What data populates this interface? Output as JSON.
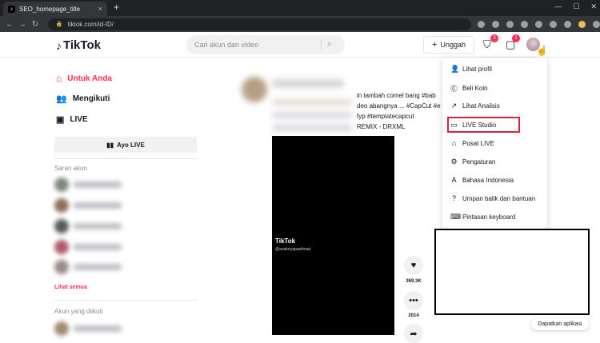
{
  "browser": {
    "tab_title": "SEO_homepage_title",
    "tab_close": "×",
    "new_tab": "+",
    "back": "←",
    "forward": "→",
    "reload": "↻",
    "url": "tiktok.com/id-ID/",
    "window_controls": [
      "—",
      "☐",
      "✕"
    ]
  },
  "header": {
    "logo_text": "TikTok",
    "search_placeholder": "Cari akun dan video",
    "upload_label": "Unggah",
    "inbox_badge": "3",
    "messages_badge": "1"
  },
  "sidebar": {
    "nav": [
      {
        "label": "Untuk Anda",
        "active": true
      },
      {
        "label": "Mengikuti",
        "active": false
      },
      {
        "label": "LIVE",
        "active": false
      }
    ],
    "go_live_label": "Ayo LIVE",
    "suggested_label": "Saran akun",
    "see_all_label": "Lihat semua",
    "following_label": "Akun yang diikuti"
  },
  "feed": {
    "caption_lines": [
      "in tambah comel bang #bab",
      "deo abangnya ... #CapCut #e",
      "fyp #templatecapcut",
      "REMIX - DRXML"
    ],
    "video_logo": "TikTok",
    "video_user": "@anaknyapaalimad",
    "likes": "369.3K",
    "comments": "2014"
  },
  "dropdown": {
    "items": [
      {
        "label": "Lihat profil",
        "icon": "user-icon"
      },
      {
        "label": "Beli Koin",
        "icon": "coin-icon"
      },
      {
        "label": "Lihat Analisis",
        "icon": "analytics-icon"
      },
      {
        "label": "LIVE Studio",
        "icon": "live-studio-icon"
      },
      {
        "label": "Pusat LIVE",
        "icon": "live-center-icon"
      },
      {
        "label": "Pengaturan",
        "icon": "settings-icon"
      },
      {
        "label": "Bahasa Indonesia",
        "icon": "language-icon"
      },
      {
        "label": "Umpan balik dan bantuan",
        "icon": "help-icon"
      },
      {
        "label": "Pintasan keyboard",
        "icon": "keyboard-icon"
      }
    ]
  },
  "get_app_label": "Dapatkan aplikasi",
  "colors": {
    "accent": "#fe2c55",
    "highlight": "#d9243a"
  }
}
